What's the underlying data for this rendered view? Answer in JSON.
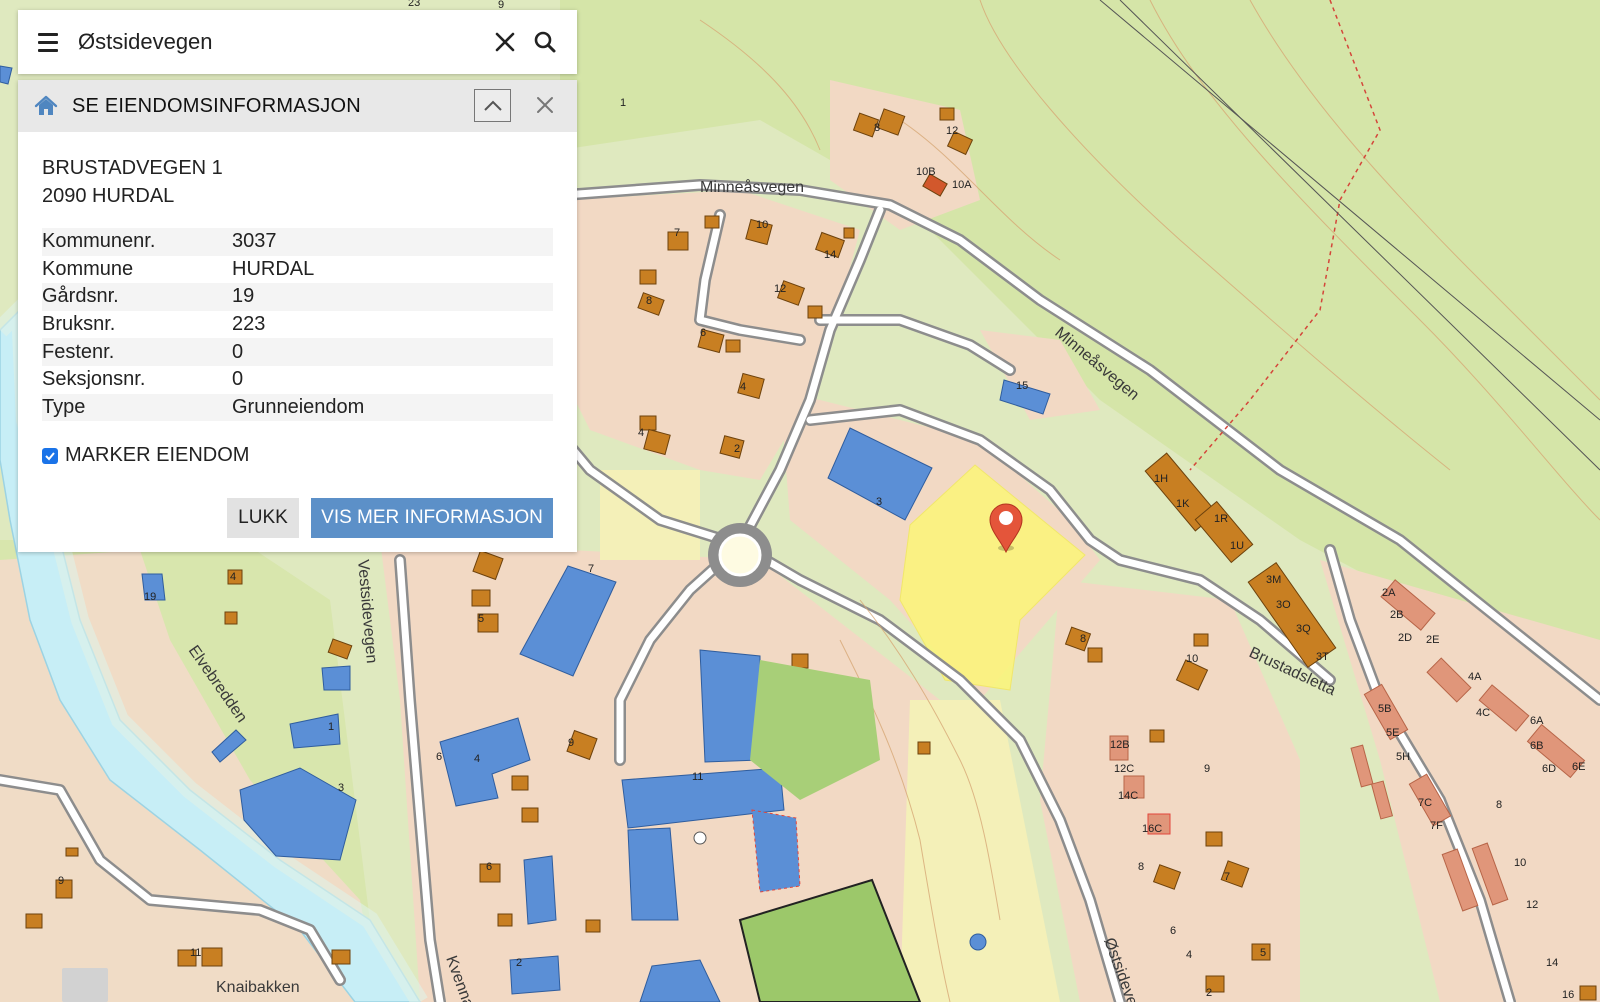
{
  "search": {
    "value": "Østsidevegen"
  },
  "panel": {
    "title": "SE EIENDOMSINFORMASJON",
    "address_line1": "BRUSTADVEGEN 1",
    "address_line2": "2090 HURDAL",
    "rows": [
      {
        "label": "Kommunenr.",
        "value": "3037"
      },
      {
        "label": "Kommune",
        "value": "HURDAL"
      },
      {
        "label": "Gårdsnr.",
        "value": "19"
      },
      {
        "label": "Bruksnr.",
        "value": "223"
      },
      {
        "label": "Festenr.",
        "value": "0"
      },
      {
        "label": "Seksjonsnr.",
        "value": "0"
      },
      {
        "label": "Type",
        "value": "Grunneiendom"
      }
    ],
    "mark_label": "MARKER EIENDOM",
    "mark_checked": true,
    "close_label": "LUKK",
    "more_label": "VIS MER INFORMASJON"
  },
  "map": {
    "streets": {
      "minneasvegen_1": "Minneåsvegen",
      "minneasvegen_2": "Minneåsvegen",
      "vestsidevegen": "Vestsidevegen",
      "elvebredden": "Elvebredden",
      "brustadsletta": "Brustadsletta",
      "ostsidevegen": "Østsidevegen",
      "knaibakken": "Knaibakken",
      "kvenna": "Kvenna"
    },
    "house_numbers": {
      "n1": "1",
      "n8a": "8",
      "n12a": "12",
      "n10b": "10B",
      "n10a": "10A",
      "n7a": "7",
      "n10c": "10",
      "n14a": "14",
      "n12b": "12",
      "n8b": "8",
      "n6a": "6",
      "n4a": "4",
      "n4b": "4",
      "n2a": "2",
      "n3a": "3",
      "n15": "15",
      "n1h": "1H",
      "n1k": "1K",
      "n1r": "1R",
      "n1u": "1U",
      "n3m": "3M",
      "n3o": "3O",
      "n3q": "3Q",
      "n3t": "3T",
      "n8c": "8",
      "n10d": "10",
      "n12bb": "12B",
      "n12cc": "12C",
      "n14cc": "14C",
      "n16cc": "16C",
      "n9a": "9",
      "n2aa": "2A",
      "n2bb": "2B",
      "n2dd": "2D",
      "n2ee": "2E",
      "n4aa": "4A",
      "n4cc": "4C",
      "n5bb": "5B",
      "n5ee": "5E",
      "n5hh": "5H",
      "n6aa": "6A",
      "n6bb": "6B",
      "n6dd": "6D",
      "n6ee": "6E",
      "n7cc": "7C",
      "n7ff": "7F",
      "n8d": "8",
      "n10e": "10",
      "n12c": "12",
      "n14b": "14",
      "n16": "16",
      "n19": "19",
      "n4c": "4",
      "n5a": "5",
      "n7b": "7",
      "n9b": "9",
      "n6b": "6",
      "n4d": "4",
      "n1b": "1",
      "n3b": "3",
      "n11a": "11",
      "n6c": "6",
      "n2b": "2",
      "n11b": "11",
      "n9c": "9",
      "n8e": "8",
      "n7c": "7",
      "n6d": "6",
      "n4e": "4",
      "n5b": "5",
      "n2c": "2",
      "n23": "23",
      "n9d": "9"
    }
  }
}
